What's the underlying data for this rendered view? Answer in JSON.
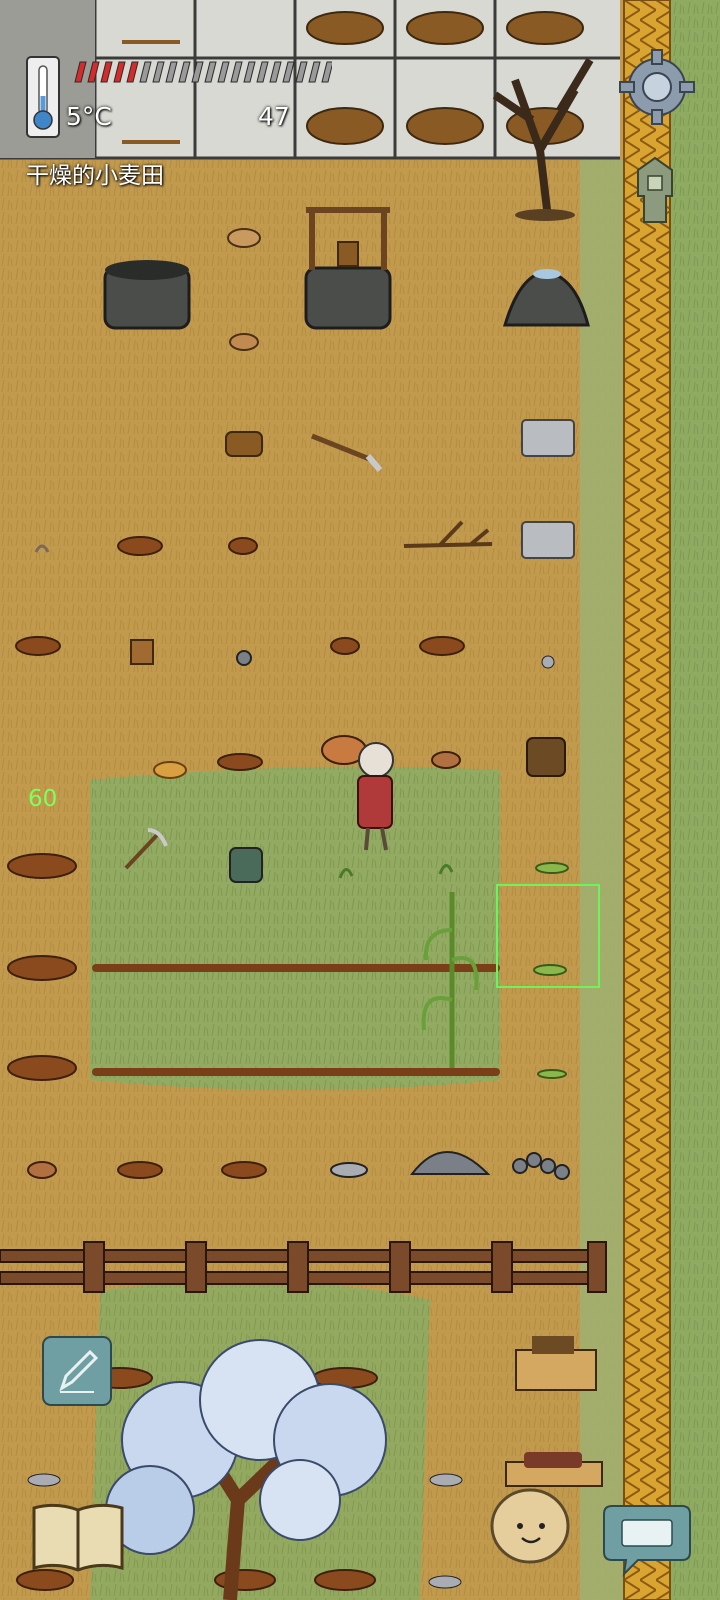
{
  "hud": {
    "temperature": "5°C",
    "food_value": "47",
    "location": "干燥的小麦田",
    "hunger_fill": 0.25,
    "yum_bonus": "60"
  },
  "icons": {
    "thermometer": "thermometer-icon",
    "settings": "gear-icon",
    "tech": "tech-tree-icon",
    "edit": "pencil-icon",
    "book": "recipe-book-icon",
    "emote": "emote-face-icon",
    "chat": "keyboard-icon"
  },
  "colors": {
    "dry_grass": "#c29a4e",
    "green_grass": "#8fab62",
    "stone_floor": "#d8d9d3",
    "hunger_red": "#d62b2b",
    "selection_green": "#6ff35a",
    "rope_gold": "#d9a530",
    "fence_brown": "#7a4a2a"
  }
}
